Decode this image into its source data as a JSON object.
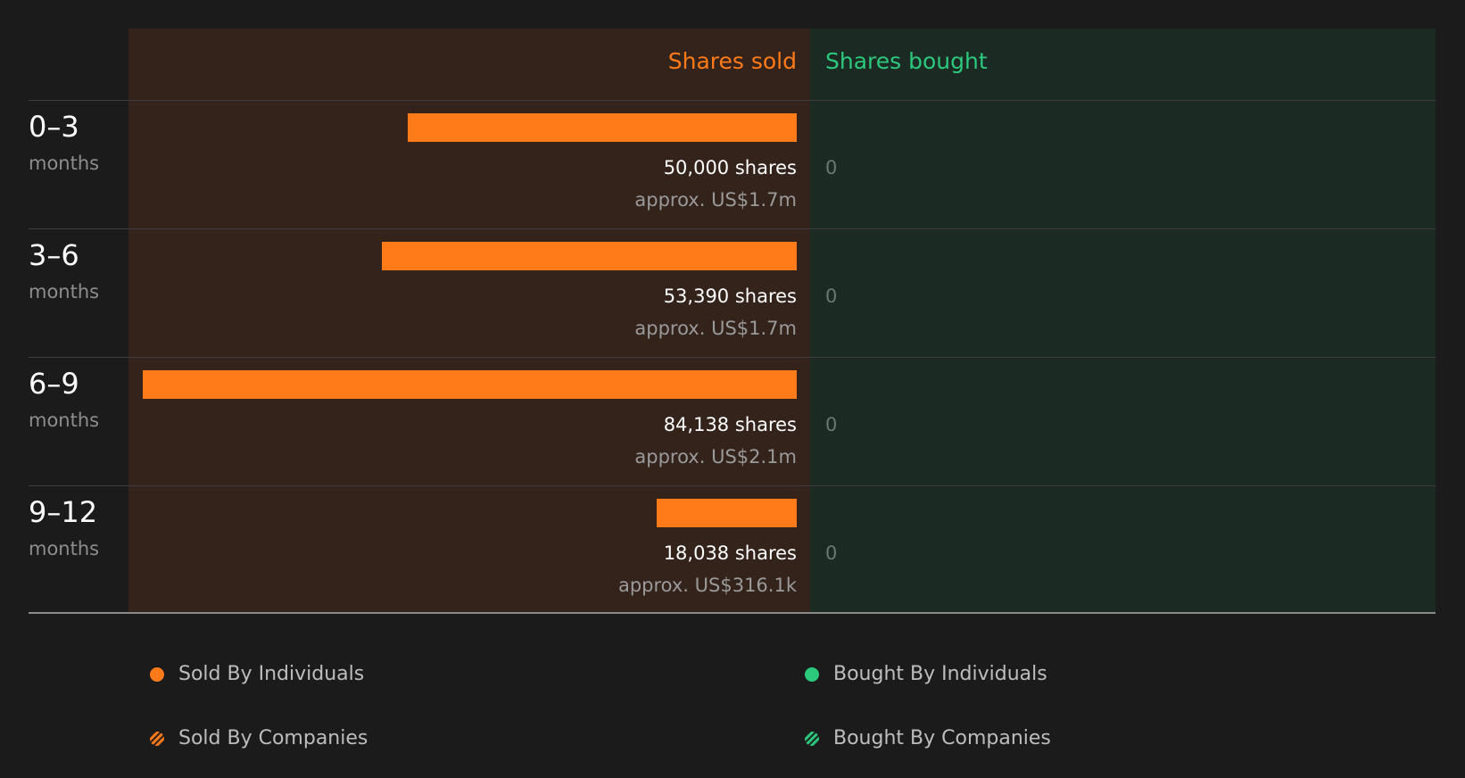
{
  "header": {
    "sold": "Shares sold",
    "bought": "Shares bought"
  },
  "colors": {
    "sold": "#ff7a19",
    "bought": "#2cc87c"
  },
  "rows": [
    {
      "period": "0–3",
      "unit": "months",
      "shares_label": "50,000 shares",
      "approx_label": "approx. US$1.7m",
      "bought_label": "0"
    },
    {
      "period": "3–6",
      "unit": "months",
      "shares_label": "53,390 shares",
      "approx_label": "approx. US$1.7m",
      "bought_label": "0"
    },
    {
      "period": "6–9",
      "unit": "months",
      "shares_label": "84,138 shares",
      "approx_label": "approx. US$2.1m",
      "bought_label": "0"
    },
    {
      "period": "9–12",
      "unit": "months",
      "shares_label": "18,038 shares",
      "approx_label": "approx. US$316.1k",
      "bought_label": "0"
    }
  ],
  "legend": {
    "sold_individuals": "Sold By Individuals",
    "bought_individuals": "Bought By Individuals",
    "sold_companies": "Sold By Companies",
    "bought_companies": "Bought By Companies"
  },
  "chart_data": {
    "type": "bar",
    "orientation": "horizontal-diverging",
    "categories": [
      "0–3 months",
      "3–6 months",
      "6–9 months",
      "9–12 months"
    ],
    "series": [
      {
        "name": "Shares sold",
        "values": [
          50000,
          53390,
          84138,
          18038
        ],
        "approx_values": [
          "approx. US$1.7m",
          "approx. US$1.7m",
          "approx. US$2.1m",
          "approx. US$316.1k"
        ]
      },
      {
        "name": "Shares bought",
        "values": [
          0,
          0,
          0,
          0
        ]
      }
    ],
    "legend": [
      "Sold By Individuals",
      "Sold By Companies",
      "Bought By Individuals",
      "Bought By Companies"
    ],
    "legend_position": "bottom"
  }
}
